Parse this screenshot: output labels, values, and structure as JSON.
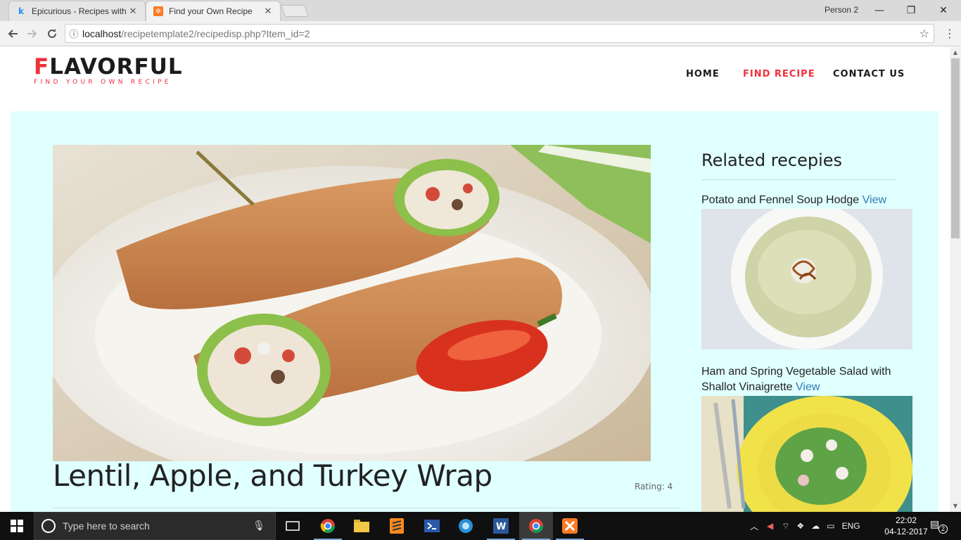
{
  "browser": {
    "tabs": [
      {
        "title": "Epicurious - Recipes with",
        "favicon": "k-favicon",
        "active": false
      },
      {
        "title": "Find your Own Recipe",
        "favicon": "xampp-favicon",
        "active": true
      }
    ],
    "profile_label": "Person 2",
    "url_host": "localhost",
    "url_path": "/recipetemplate2/recipedisp.php?Item_id=2"
  },
  "site": {
    "logo_first": "F",
    "logo_rest": "LAVORFUL",
    "tagline": "FIND YOUR OWN RECIPE",
    "nav": [
      {
        "label": "HOME",
        "active": false
      },
      {
        "label": "FIND RECIPE",
        "active": true
      },
      {
        "label": "CONTACT US",
        "active": false
      }
    ]
  },
  "recipe": {
    "title": "Lentil, Apple, and Turkey Wrap",
    "rating_label": "Rating: 4",
    "image": "turkey-wrap-photo"
  },
  "related": {
    "heading": "Related recepies",
    "items": [
      {
        "name": "Potato and Fennel Soup Hodge",
        "view_label": "View",
        "image": "soup-bowl-photo"
      },
      {
        "name": "Ham and Spring Vegetable Salad with Shallot Vinaigrette",
        "view_label": "View",
        "image": "salad-plate-photo"
      }
    ]
  },
  "taskbar": {
    "search_placeholder": "Type here to search",
    "language": "ENG",
    "time": "22:02",
    "date": "04-12-2017",
    "notification_count": "2"
  },
  "colors": {
    "accent": "#f0303a",
    "panel_bg": "#e0ffff",
    "link": "#337ab7"
  }
}
